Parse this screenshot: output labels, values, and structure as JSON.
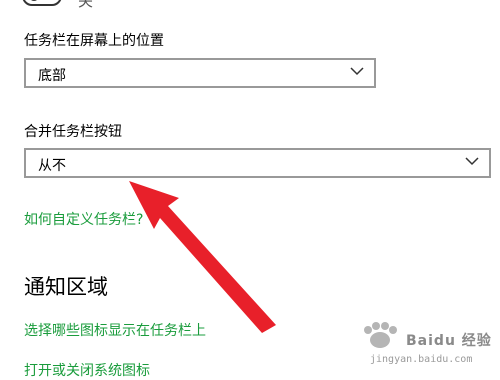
{
  "top_toggle": {
    "label": "关"
  },
  "taskbar_position": {
    "label": "任务栏在屏幕上的位置",
    "value": "底部"
  },
  "combine_buttons": {
    "label": "合并任务栏按钮",
    "value": "从不"
  },
  "links": {
    "customize": "如何自定义任务栏?",
    "select_icons": "选择哪些图标显示在任务栏上",
    "system_icons": "打开或关闭系统图标"
  },
  "notification_area": {
    "title": "通知区域"
  },
  "watermark": {
    "brand": "Baidu 经验",
    "url": "jingyan.baidu.com"
  },
  "colors": {
    "link": "#1a9c3c",
    "arrow": "#e8202a",
    "border": "#999999"
  }
}
